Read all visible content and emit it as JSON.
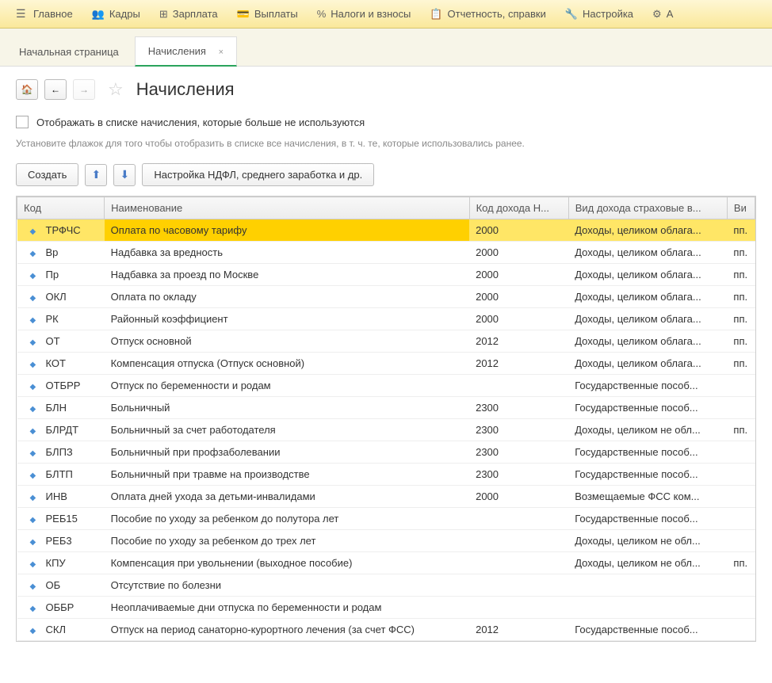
{
  "nav": {
    "items": [
      {
        "icon": "☰",
        "label": "Главное"
      },
      {
        "icon": "👥",
        "label": "Кадры"
      },
      {
        "icon": "⊞",
        "label": "Зарплата"
      },
      {
        "icon": "💳",
        "label": "Выплаты"
      },
      {
        "icon": "%",
        "label": "Налоги и взносы"
      },
      {
        "icon": "📋",
        "label": "Отчетность, справки"
      },
      {
        "icon": "🔧",
        "label": "Настройка"
      },
      {
        "icon": "⚙",
        "label": "А"
      }
    ]
  },
  "tabs": {
    "home": "Начальная страница",
    "active": "Начисления"
  },
  "page": {
    "title": "Начисления"
  },
  "filter": {
    "label": "Отображать в списке начисления, которые больше не используются",
    "hint": "Установите флажок для того чтобы отобразить в списке все начисления, в т. ч. те, которые использовались ранее."
  },
  "toolbar": {
    "create": "Создать",
    "settings": "Настройка НДФЛ, среднего заработка и др."
  },
  "table": {
    "headers": {
      "code": "Код",
      "name": "Наименование",
      "income_code": "Код дохода Н...",
      "insurance_type": "Вид дохода страховые в...",
      "extra": "Ви"
    },
    "rows": [
      {
        "code": "ТРФЧС",
        "name": "Оплата по часовому тарифу",
        "income": "2000",
        "insurance": "Доходы, целиком облага...",
        "extra": "пп.",
        "selected": true
      },
      {
        "code": "Вр",
        "name": "Надбавка за вредность",
        "income": "2000",
        "insurance": "Доходы, целиком облага...",
        "extra": "пп."
      },
      {
        "code": "Пр",
        "name": "Надбавка за проезд по Москве",
        "income": "2000",
        "insurance": "Доходы, целиком облага...",
        "extra": "пп."
      },
      {
        "code": "ОКЛ",
        "name": "Оплата по окладу",
        "income": "2000",
        "insurance": "Доходы, целиком облага...",
        "extra": "пп."
      },
      {
        "code": "РК",
        "name": "Районный коэффициент",
        "income": "2000",
        "insurance": "Доходы, целиком облага...",
        "extra": "пп."
      },
      {
        "code": "ОТ",
        "name": "Отпуск основной",
        "income": "2012",
        "insurance": "Доходы, целиком облага...",
        "extra": "пп."
      },
      {
        "code": "КОТ",
        "name": "Компенсация отпуска (Отпуск основной)",
        "income": "2012",
        "insurance": "Доходы, целиком облага...",
        "extra": "пп."
      },
      {
        "code": "ОТБРР",
        "name": "Отпуск по беременности и родам",
        "income": "",
        "insurance": "Государственные пособ...",
        "extra": ""
      },
      {
        "code": "БЛН",
        "name": "Больничный",
        "income": "2300",
        "insurance": "Государственные пособ...",
        "extra": ""
      },
      {
        "code": "БЛРДТ",
        "name": "Больничный за счет работодателя",
        "income": "2300",
        "insurance": "Доходы, целиком не обл...",
        "extra": "пп."
      },
      {
        "code": "БЛПЗ",
        "name": "Больничный при профзаболевании",
        "income": "2300",
        "insurance": "Государственные пособ...",
        "extra": ""
      },
      {
        "code": "БЛТП",
        "name": "Больничный при травме на производстве",
        "income": "2300",
        "insurance": "Государственные пособ...",
        "extra": ""
      },
      {
        "code": "ИНВ",
        "name": "Оплата дней ухода за детьми-инвалидами",
        "income": "2000",
        "insurance": "Возмещаемые ФСС ком...",
        "extra": ""
      },
      {
        "code": "РЕБ15",
        "name": "Пособие по уходу за ребенком до полутора лет",
        "income": "",
        "insurance": "Государственные пособ...",
        "extra": ""
      },
      {
        "code": "РЕБ3",
        "name": "Пособие по уходу за ребенком до трех лет",
        "income": "",
        "insurance": "Доходы, целиком не обл...",
        "extra": ""
      },
      {
        "code": "КПУ",
        "name": "Компенсация при увольнении (выходное пособие)",
        "income": "",
        "insurance": "Доходы, целиком не обл...",
        "extra": "пп."
      },
      {
        "code": "ОБ",
        "name": "Отсутствие по болезни",
        "income": "",
        "insurance": "",
        "extra": ""
      },
      {
        "code": "ОББР",
        "name": "Неоплачиваемые дни отпуска по беременности и родам",
        "income": "",
        "insurance": "",
        "extra": ""
      },
      {
        "code": "СКЛ",
        "name": "Отпуск на период санаторно-курортного лечения (за счет ФСС)",
        "income": "2012",
        "insurance": "Государственные пособ...",
        "extra": ""
      }
    ]
  }
}
